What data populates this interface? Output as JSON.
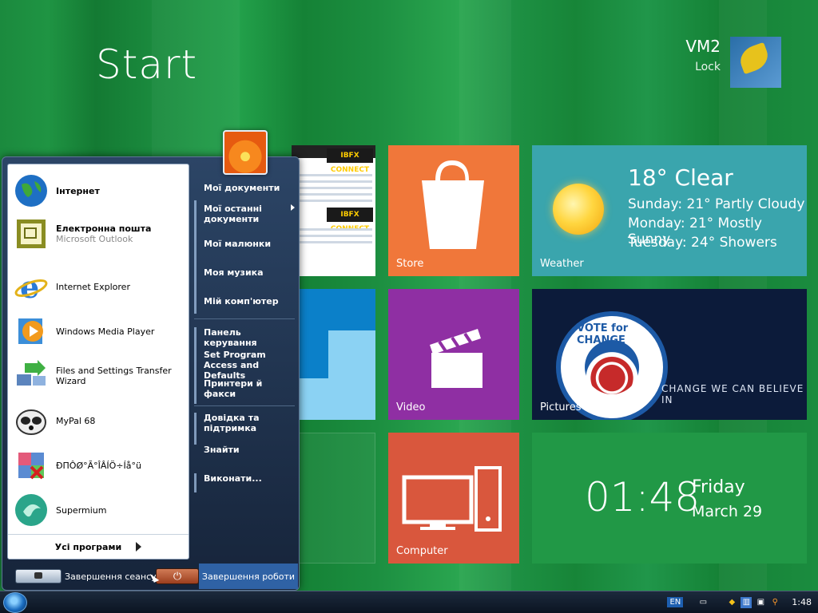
{
  "start_screen": {
    "title": "Start",
    "user": {
      "name": "VM2",
      "lock_label": "Lock"
    }
  },
  "tiles": {
    "store_label": "Store",
    "weather": {
      "label": "Weather",
      "current": "18° Clear",
      "forecast": [
        "Sunday: 21° Partly Cloudy",
        "Monday: 21° Mostly Sunny",
        "Tuesday: 24° Showers"
      ]
    },
    "video_label": "Video",
    "pictures": {
      "label": "Pictures",
      "badge_text": "VOTE for CHANGE",
      "slogan": "CHANGE WE CAN BELIEVE IN"
    },
    "computer_label": "Computer",
    "clock": {
      "time": "01:48",
      "day": "Friday",
      "date": "March 29"
    },
    "ibfx_text": "IBFX CONNECT"
  },
  "start_menu": {
    "programs": [
      {
        "title": "Інтернет",
        "subtitle": "",
        "icon": "globe-icon",
        "bold": true
      },
      {
        "title": "Електронна пошта",
        "subtitle": "Microsoft Outlook",
        "icon": "outlook-icon",
        "bold": true
      },
      {
        "title": "Internet Explorer",
        "subtitle": "",
        "icon": "ie-icon",
        "bold": false
      },
      {
        "title": "Windows Media Player",
        "subtitle": "",
        "icon": "media-player-icon",
        "bold": false
      },
      {
        "title": "Files and Settings Transfer Wizard",
        "subtitle": "",
        "icon": "transfer-wizard-icon",
        "bold": false
      },
      {
        "title": "MyPal 68",
        "subtitle": "",
        "icon": "mypal-icon",
        "bold": false
      },
      {
        "title": "ÐПÔØ°Ã°ÎÂÍÖ÷Íå°ü",
        "subtitle": "",
        "icon": "app-icon",
        "bold": false
      },
      {
        "title": "Supermium",
        "subtitle": "",
        "icon": "supermium-icon",
        "bold": false
      }
    ],
    "all_programs": "Усі програми",
    "places": [
      {
        "label": "Мої документи",
        "arrow": false
      },
      {
        "label": "Мої останні документи",
        "arrow": true
      },
      {
        "label": "Мої малюнки",
        "arrow": false
      },
      {
        "label": "Моя музика",
        "arrow": false
      },
      {
        "label": "Мій комп'ютер",
        "arrow": false
      },
      {
        "label": "Панель керування",
        "arrow": false
      },
      {
        "label": "Set Program Access and Defaults",
        "arrow": false
      },
      {
        "label": "Принтери й факси",
        "arrow": false
      },
      {
        "label": "Довідка та підтримка",
        "arrow": false
      },
      {
        "label": "Знайти",
        "arrow": false
      },
      {
        "label": "Виконати...",
        "arrow": false
      }
    ],
    "logoff_label": "Завершення сеансу",
    "shutdown_label": "Завершення роботи"
  },
  "taskbar": {
    "language": "EN",
    "clock": "1:48"
  },
  "colors": {
    "store": "#f0773a",
    "weather": "#3aa5ad",
    "video": "#8f2fa3",
    "computer": "#d9573d",
    "clock_tile": "#219846",
    "accent": "#2f62a5"
  }
}
